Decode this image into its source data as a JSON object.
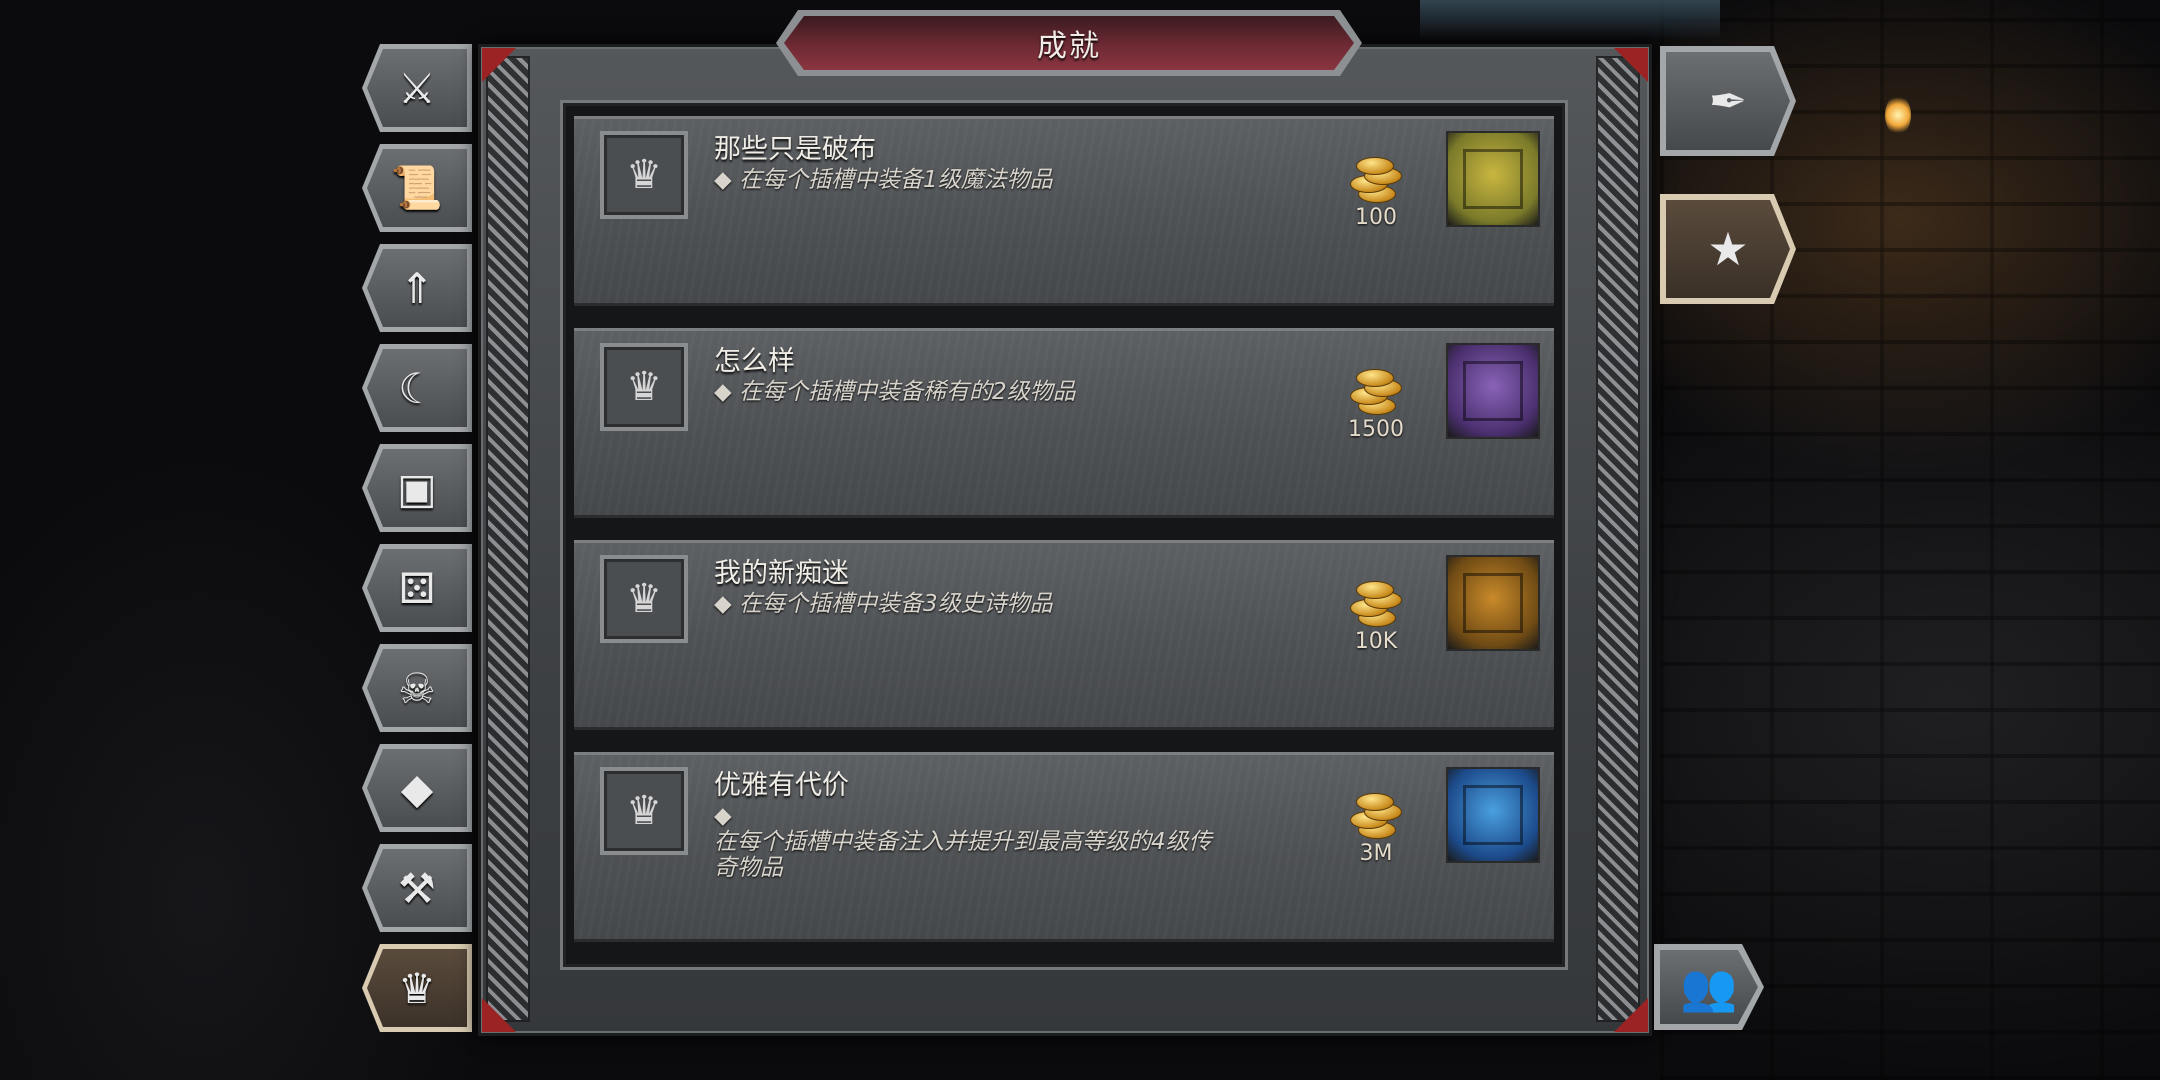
{
  "title": "成就",
  "left_nav": [
    {
      "icon": "sword-icon",
      "glyph": "⚔"
    },
    {
      "icon": "scroll-icon",
      "glyph": "📜"
    },
    {
      "icon": "winged-arrow-icon",
      "glyph": "⇑"
    },
    {
      "icon": "moon-blade-icon",
      "glyph": "☾"
    },
    {
      "icon": "chest-icon",
      "glyph": "▣"
    },
    {
      "icon": "dice-icon",
      "glyph": "⚄"
    },
    {
      "icon": "horned-skull-icon",
      "glyph": "☠"
    },
    {
      "icon": "diamond-icon",
      "glyph": "◆"
    },
    {
      "icon": "hammer-icon",
      "glyph": "⚒"
    },
    {
      "icon": "achievement-trophy-icon",
      "glyph": "♛"
    }
  ],
  "right_nav": [
    {
      "icon": "feather-icon",
      "glyph": "✒"
    },
    {
      "icon": "laurel-star-icon",
      "glyph": "★"
    },
    {
      "icon": "group-icon",
      "glyph": "👥"
    }
  ],
  "achievements": [
    {
      "title": "那些只是破布",
      "desc": "◆ 在每个插槽中装备1级魔法物品",
      "reward": "100",
      "chest_color": "#7a7a2a",
      "chest_accent": "#c9b640"
    },
    {
      "title": "怎么样",
      "desc": "◆ 在每个插槽中装备稀有的2级物品",
      "reward": "1500",
      "chest_color": "#4a2f6e",
      "chest_accent": "#8a63b8"
    },
    {
      "title": "我的新痴迷",
      "desc": "◆ 在每个插槽中装备3级史诗物品",
      "reward": "10K",
      "chest_color": "#6e4a14",
      "chest_accent": "#c98a2a"
    },
    {
      "title": "优雅有代价",
      "desc": "◆\n在每个插槽中装备注入并提升到最高等级的4级传奇物品",
      "reward": "3M",
      "chest_color": "#1c4a8a",
      "chest_accent": "#4aa0e0"
    }
  ]
}
